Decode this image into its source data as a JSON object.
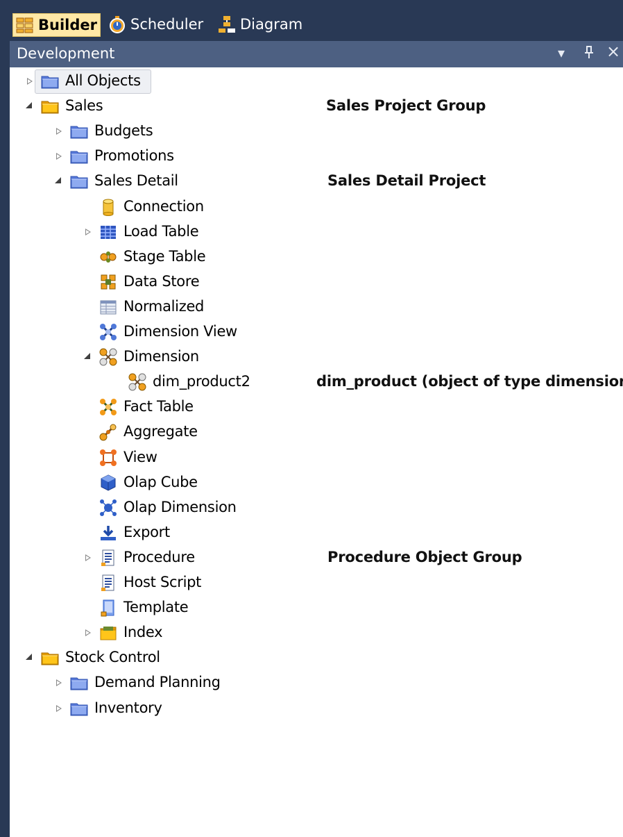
{
  "tabs": [
    {
      "label": "Builder",
      "icon": "builder-icon",
      "active": true
    },
    {
      "label": "Scheduler",
      "icon": "stopwatch-icon",
      "active": false
    },
    {
      "label": "Diagram",
      "icon": "diagram-icon",
      "active": false
    }
  ],
  "pane": {
    "title": "Development",
    "dropdown_glyph": "▾",
    "pin_glyph": "ᚖ",
    "close_glyph": "×"
  },
  "tree": [
    {
      "label": "All Objects",
      "icon": "folder-blue-icon",
      "expander": "collapsed",
      "selected": true
    },
    {
      "label": "Sales",
      "icon": "folder-yellow-icon",
      "expander": "expanded"
    },
    {
      "label": "Budgets",
      "icon": "folder-blue-icon",
      "expander": "collapsed"
    },
    {
      "label": "Promotions",
      "icon": "folder-blue-icon",
      "expander": "collapsed"
    },
    {
      "label": "Sales Detail",
      "icon": "folder-blue-icon",
      "expander": "expanded"
    },
    {
      "label": "Connection",
      "icon": "connection-cylinder-icon",
      "expander": "none"
    },
    {
      "label": "Load Table",
      "icon": "load-table-icon",
      "expander": "collapsed"
    },
    {
      "label": "Stage Table",
      "icon": "stage-table-icon",
      "expander": "none"
    },
    {
      "label": "Data Store",
      "icon": "data-store-icon",
      "expander": "none"
    },
    {
      "label": "Normalized",
      "icon": "normalized-table-icon",
      "expander": "none"
    },
    {
      "label": "Dimension View",
      "icon": "dimension-view-icon",
      "expander": "none"
    },
    {
      "label": "Dimension",
      "icon": "dimension-icon",
      "expander": "expanded"
    },
    {
      "label": "dim_product2",
      "icon": "dimension-object-icon",
      "expander": "none"
    },
    {
      "label": "Fact Table",
      "icon": "fact-table-icon",
      "expander": "none"
    },
    {
      "label": "Aggregate",
      "icon": "aggregate-icon",
      "expander": "none"
    },
    {
      "label": "View",
      "icon": "view-icon",
      "expander": "none"
    },
    {
      "label": "Olap Cube",
      "icon": "olap-cube-icon",
      "expander": "none"
    },
    {
      "label": "Olap Dimension",
      "icon": "olap-dimension-icon",
      "expander": "none"
    },
    {
      "label": "Export",
      "icon": "export-icon",
      "expander": "none"
    },
    {
      "label": "Procedure",
      "icon": "procedure-icon",
      "expander": "collapsed"
    },
    {
      "label": "Host Script",
      "icon": "host-script-icon",
      "expander": "none"
    },
    {
      "label": "Template",
      "icon": "template-icon",
      "expander": "none"
    },
    {
      "label": "Index",
      "icon": "index-icon",
      "expander": "collapsed"
    },
    {
      "label": "Stock Control",
      "icon": "folder-yellow-icon",
      "expander": "expanded"
    },
    {
      "label": "Demand Planning",
      "icon": "folder-blue-icon",
      "expander": "collapsed"
    },
    {
      "label": "Inventory",
      "icon": "folder-blue-icon",
      "expander": "collapsed"
    }
  ],
  "annotations": [
    {
      "label": "Sales Project Group"
    },
    {
      "label": "Sales Detail Project"
    },
    {
      "label": "dim_product (object of type dimension)"
    },
    {
      "label": "Procedure Object Group"
    }
  ],
  "colors": {
    "frame": "#293955",
    "pane_header": "#4d6082",
    "active_tab": "#ffe8a6",
    "folder_blue": "#6d8fe0",
    "folder_yellow": "#f5b800"
  }
}
